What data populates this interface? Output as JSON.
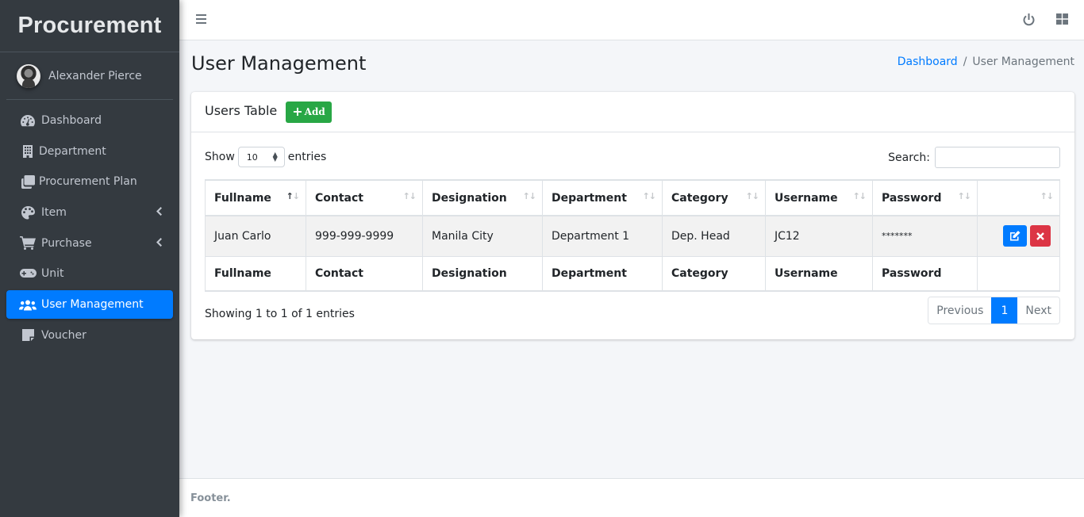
{
  "sidebar": {
    "brand": "Procurement",
    "user_name": "Alexander Pierce",
    "items": [
      {
        "label": "Dashboard",
        "icon": "tachometer-icon",
        "active": false,
        "has_caret": false
      },
      {
        "label": "Department",
        "icon": "building-icon",
        "active": false,
        "has_caret": false
      },
      {
        "label": "Procurement Plan",
        "icon": "clone-icon",
        "active": false,
        "has_caret": false
      },
      {
        "label": "Item",
        "icon": "palette-icon",
        "active": false,
        "has_caret": true
      },
      {
        "label": "Purchase",
        "icon": "shopping-cart-icon",
        "active": false,
        "has_caret": true
      },
      {
        "label": "Unit",
        "icon": "gamepad-icon",
        "active": false,
        "has_caret": false
      },
      {
        "label": "User Management",
        "icon": "users-icon",
        "active": true,
        "has_caret": false
      },
      {
        "label": "Voucher",
        "icon": "sticky-note-icon",
        "active": false,
        "has_caret": false
      }
    ]
  },
  "topbar": {
    "menu_icon": "hamburger-icon",
    "right_icons": [
      "power-icon",
      "grid-icon"
    ]
  },
  "header": {
    "title": "User Management",
    "breadcrumb": [
      {
        "label": "Dashboard",
        "link": true
      },
      {
        "label": "/",
        "link": false
      },
      {
        "label": "User Management",
        "link": false
      }
    ]
  },
  "card": {
    "title": "Users Table",
    "add_button": "Add",
    "length_prefix": "Show",
    "length_value": "10",
    "length_suffix": "entries",
    "search_label": "Search:",
    "search_value": "",
    "columns": [
      "Fullname",
      "Contact",
      "Designation",
      "Department",
      "Category",
      "Username",
      "Password",
      ""
    ],
    "rows": [
      {
        "fullname": "Juan Carlo",
        "contact": "999-999-9999",
        "designation": "Manila City",
        "department": "Department 1",
        "category": "Dep. Head",
        "username": "JC12",
        "password": "*******"
      }
    ],
    "footer_columns": [
      "Fullname",
      "Contact",
      "Designation",
      "Department",
      "Category",
      "Username",
      "Password",
      ""
    ],
    "info": "Showing 1 to 1 of 1 entries",
    "pagination": {
      "previous": "Previous",
      "current": "1",
      "next": "Next"
    }
  },
  "footer": {
    "text": "Footer."
  },
  "colors": {
    "sidebar_bg": "#343a40",
    "primary": "#007bff",
    "success": "#28a745",
    "danger": "#dc3545",
    "content_bg": "#f4f6f9"
  }
}
